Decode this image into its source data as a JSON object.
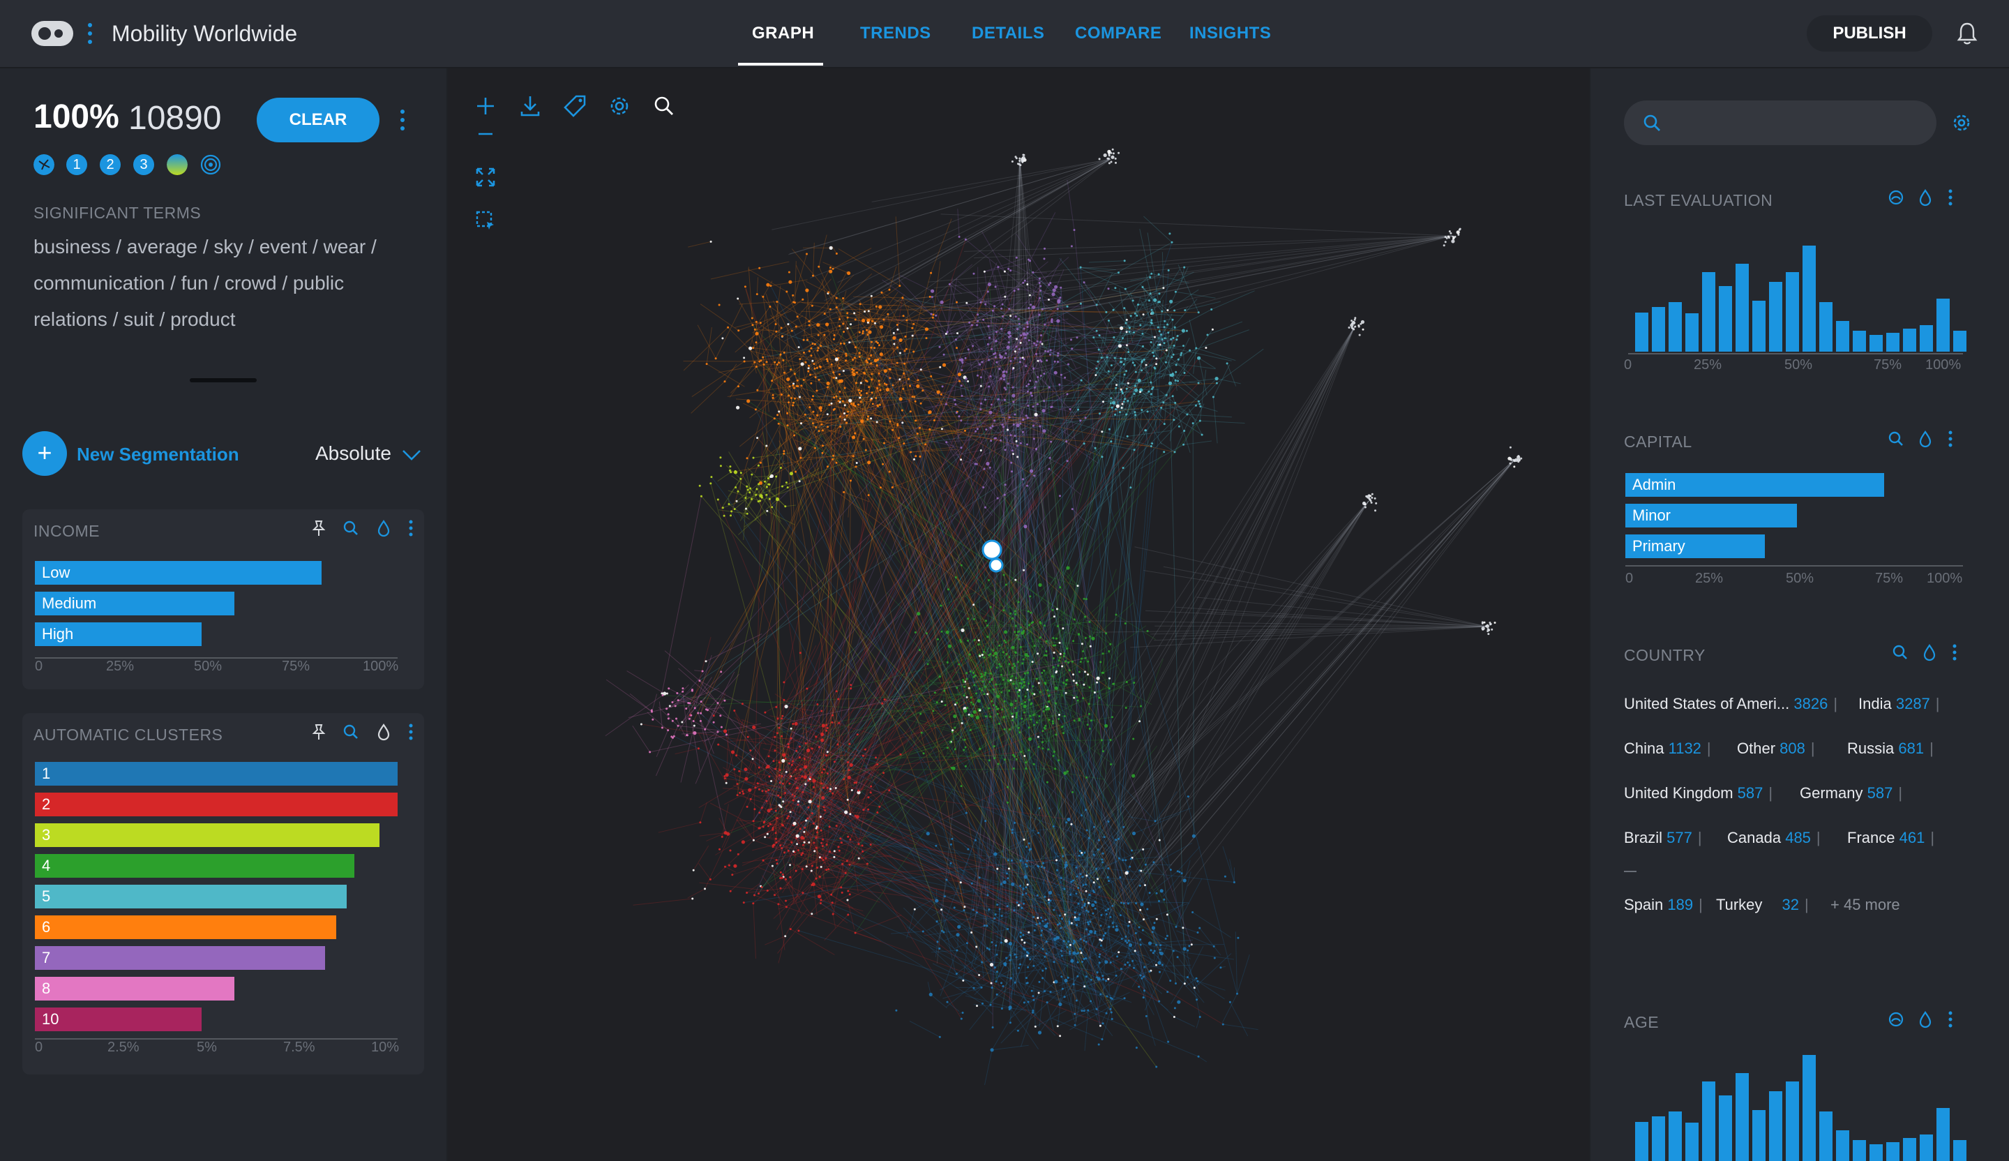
{
  "app": {
    "title": "Mobility Worldwide",
    "tabs": [
      {
        "label": "GRAPH",
        "active": true
      },
      {
        "label": "TRENDS"
      },
      {
        "label": "DETAILS"
      },
      {
        "label": "COMPARE"
      },
      {
        "label": "INSIGHTS"
      }
    ],
    "publish_label": "PUBLISH"
  },
  "selection": {
    "percent": "100%",
    "count": "10890",
    "clear_label": "CLEAR",
    "chips": [
      "1",
      "2",
      "3"
    ]
  },
  "significant_terms": {
    "label": "SIGNIFICANT TERMS",
    "lines": [
      "business / average  / sky / event / wear /",
      "communication / fun / crowd / public",
      "relations / suit / product"
    ]
  },
  "segmentation": {
    "new_label": "New Segmentation",
    "mode": "Absolute"
  },
  "income": {
    "title": "INCOME",
    "bars": [
      {
        "label": "Low",
        "value": 0.79
      },
      {
        "label": "Medium",
        "value": 0.55
      },
      {
        "label": "High",
        "value": 0.46
      }
    ],
    "ticks": [
      "0",
      "25%",
      "50%",
      "75%",
      "100%"
    ]
  },
  "clusters": {
    "title": "AUTOMATIC CLUSTERS",
    "bars": [
      {
        "label": "1",
        "value": 10.2,
        "color": "#1f77b4"
      },
      {
        "label": "2",
        "value": 10.0,
        "color": "#d62728"
      },
      {
        "label": "3",
        "value": 9.5,
        "color": "#bcdb22"
      },
      {
        "label": "4",
        "value": 8.8,
        "color": "#2ca02c"
      },
      {
        "label": "5",
        "value": 8.6,
        "color": "#4fb8c8"
      },
      {
        "label": "6",
        "value": 8.3,
        "color": "#ff7f0e"
      },
      {
        "label": "7",
        "value": 8.0,
        "color": "#9467bd"
      },
      {
        "label": "8",
        "value": 5.5,
        "color": "#e377c2"
      },
      {
        "label": "10",
        "value": 4.6,
        "color": "#a8245e"
      }
    ],
    "ticks": [
      "0",
      "2.5%",
      "5%",
      "7.5%",
      "10%"
    ]
  },
  "search": {
    "placeholder": ""
  },
  "last_evaluation": {
    "title": "LAST EVALUATION",
    "values": [
      0.37,
      0.42,
      0.47,
      0.36,
      0.75,
      0.62,
      0.83,
      0.48,
      0.66,
      0.75,
      1.0,
      0.47,
      0.29,
      0.2,
      0.16,
      0.18,
      0.22,
      0.25,
      0.5,
      0.2
    ],
    "ticks": [
      "0",
      "25%",
      "50%",
      "75%",
      "100%"
    ]
  },
  "capital": {
    "title": "CAPITAL",
    "bars": [
      {
        "label": "Admin",
        "value": 0.8
      },
      {
        "label": "Minor",
        "value": 0.53
      },
      {
        "label": "Primary",
        "value": 0.43
      }
    ],
    "ticks": [
      "0",
      "25%",
      "50%",
      "75%",
      "100%"
    ]
  },
  "country": {
    "title": "COUNTRY",
    "items": [
      {
        "name": "United States of Ameri...",
        "count": "3826"
      },
      {
        "name": "India",
        "count": "3287"
      },
      {
        "name": "China",
        "count": "1132"
      },
      {
        "name": "Other",
        "count": "808"
      },
      {
        "name": "Russia",
        "count": "681"
      },
      {
        "name": "United Kingdom",
        "count": "587"
      },
      {
        "name": "Germany",
        "count": "587"
      },
      {
        "name": "Brazil",
        "count": "577"
      },
      {
        "name": "Canada",
        "count": "485"
      },
      {
        "name": "France",
        "count": "461"
      },
      {
        "name": "Spain",
        "count": "189"
      },
      {
        "name": "Turkey",
        "count": "32"
      }
    ],
    "more": "+ 45 more"
  },
  "age": {
    "title": "AGE",
    "values": [
      0.37,
      0.42,
      0.47,
      0.36,
      0.75,
      0.62,
      0.83,
      0.48,
      0.66,
      0.75,
      1.0,
      0.47,
      0.29,
      0.2,
      0.16,
      0.18,
      0.22,
      0.25,
      0.5,
      0.2
    ]
  },
  "colors": {
    "accent": "#1b95e0",
    "background": "#1f2126",
    "panel": "#24272d"
  }
}
